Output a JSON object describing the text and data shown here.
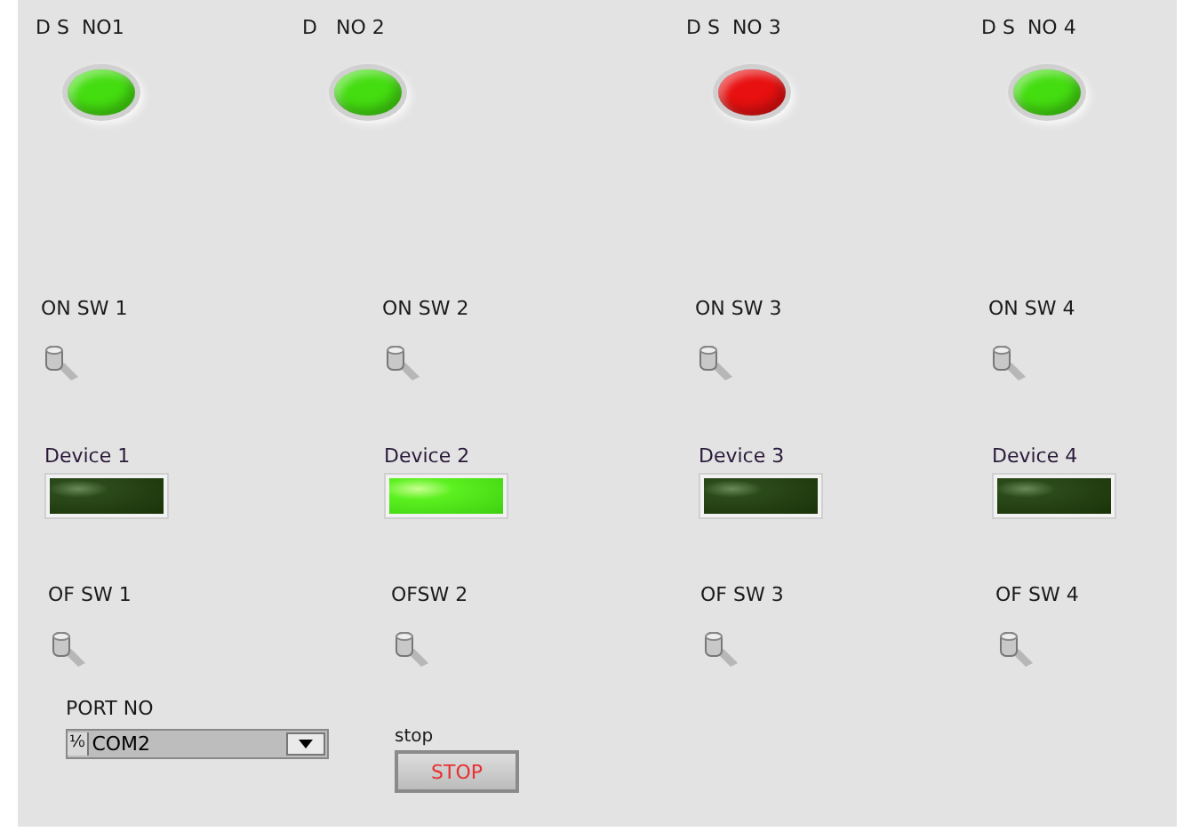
{
  "status_leds": [
    {
      "label": "D S  NO1",
      "color": "#44dd10"
    },
    {
      "label": "D   NO 2",
      "color": "#44dd10"
    },
    {
      "label": "D S  NO 3",
      "color": "#e81010"
    },
    {
      "label": "D S  NO 4",
      "color": "#44dd10"
    }
  ],
  "on_switches": [
    {
      "label": "ON SW 1",
      "on": false
    },
    {
      "label": "ON SW 2",
      "on": false
    },
    {
      "label": "ON SW 3",
      "on": false
    },
    {
      "label": "ON SW 4",
      "on": false
    }
  ],
  "devices": [
    {
      "label": "Device 1",
      "on": false
    },
    {
      "label": "Device 2",
      "on": true
    },
    {
      "label": "Device 3",
      "on": false
    },
    {
      "label": "Device 4",
      "on": false
    }
  ],
  "off_switches": [
    {
      "label": "OF SW 1",
      "on": false
    },
    {
      "label": "OFSW 2",
      "on": false
    },
    {
      "label": "OF SW 3",
      "on": false
    },
    {
      "label": "OF SW 4",
      "on": false
    }
  ],
  "port": {
    "label": "PORT NO",
    "prefix": "⅟₀",
    "value": "COM2"
  },
  "stop": {
    "label": "stop",
    "button": "STOP"
  }
}
